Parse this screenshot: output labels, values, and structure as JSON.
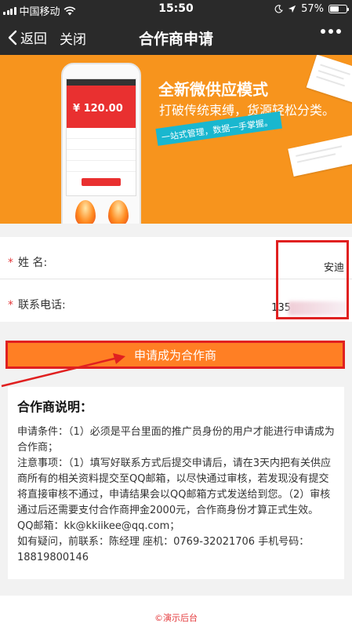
{
  "status_bar": {
    "carrier": "中国移动",
    "time": "15:50",
    "battery": "57%",
    "battery_level": 0.57
  },
  "nav": {
    "back_label": "返回",
    "close_label": "关闭",
    "title": "合作商申请"
  },
  "banner": {
    "headline": "全新微供应模式",
    "subline": "打破传统束缚，货源轻松分类。",
    "tag": "一站式管理，数据一手掌握。",
    "phone_amount": "¥ 120.00"
  },
  "form": {
    "name_label": "姓  名:",
    "name_value": "安迪",
    "phone_label": "联系电话:",
    "phone_value": "135"
  },
  "submit_label": "申请成为合作商",
  "explanation": {
    "title": "合作商说明：",
    "paragraph1": "申请条件：（1）必须是平台里面的推广员身份的用户才能进行申请成为合作商；",
    "paragraph2": "注意事项：（1）填写好联系方式后提交申请后，请在3天内把有关供应商所有的相关资料提交至QQ邮箱，以尽快通过审核，若发现没有提交将直接审核不通过，申请结果会以QQ邮箱方式发送给到您。（2）审核通过后还需要支付合作商押金2000元，合作商身份才算正式生效。",
    "qq_email": "QQ邮箱：kk@kkiikee@qq.com；",
    "contact": "如有疑问，前联系：陈经理  座机：0769-32021706  手机号码：18819800146"
  },
  "footer": "©演示后台",
  "colors": {
    "accent": "#ff7f24",
    "banner": "#f7941d",
    "highlight": "#e02020",
    "required": "#e4393c"
  }
}
